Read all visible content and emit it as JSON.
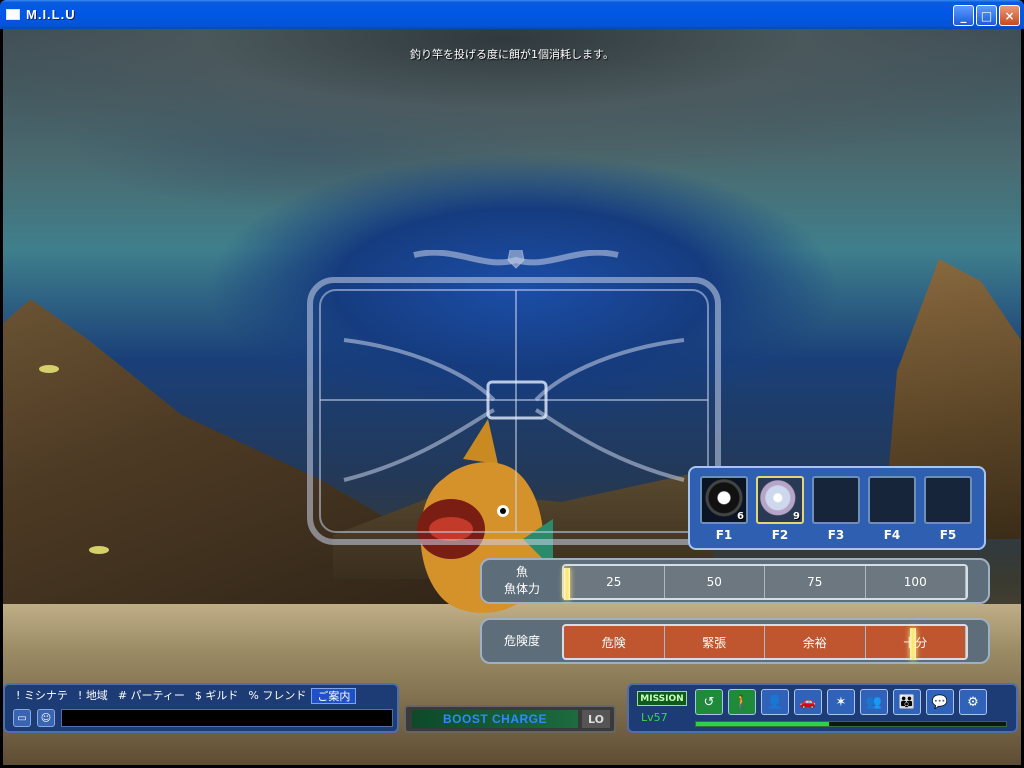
{
  "window": {
    "title": "M.I.L.U",
    "buttons": {
      "minimize": "_",
      "maximize": "□",
      "close": "×"
    }
  },
  "notice": "釣り竿を投げる度に餌が1個消耗します。",
  "quickslots": [
    {
      "key": "F1",
      "count": "6",
      "icon": "fishing-lure-icon"
    },
    {
      "key": "F2",
      "count": "9",
      "icon": "bait-orb-icon"
    },
    {
      "key": "F3",
      "count": "",
      "icon": ""
    },
    {
      "key": "F4",
      "count": "",
      "icon": ""
    },
    {
      "key": "F5",
      "count": "",
      "icon": ""
    }
  ],
  "stamina_bar": {
    "label_top": "魚",
    "label_bottom": "魚体力",
    "segments": [
      "25",
      "50",
      "75",
      "100"
    ],
    "marker_fraction": 0.0
  },
  "danger_bar": {
    "label": "危険度",
    "segments": [
      "危険",
      "緊張",
      "余裕",
      "十分"
    ],
    "marker_fraction": 0.86
  },
  "chat": {
    "tabs": [
      "! ミシナテ",
      "! 地域",
      "# パーティー",
      "$ ギルド",
      "% フレンド",
      "ご案内"
    ],
    "active_tab": 5
  },
  "boost": {
    "label": "BOOST CHARGE",
    "lo": "LO"
  },
  "menu": {
    "mission": "MISSION",
    "level": "Lv57",
    "xp_fraction": 0.43,
    "icons": [
      "return-icon",
      "character-icon",
      "profile-icon",
      "vehicle-icon",
      "skill-icon",
      "party-add-icon",
      "party-icon",
      "chat-bubble-icon",
      "settings-icon"
    ]
  },
  "colors": {
    "panel_blue": "#2f5fb0",
    "danger_orange": "#c0562f",
    "xp_green": "#2ed14a"
  }
}
